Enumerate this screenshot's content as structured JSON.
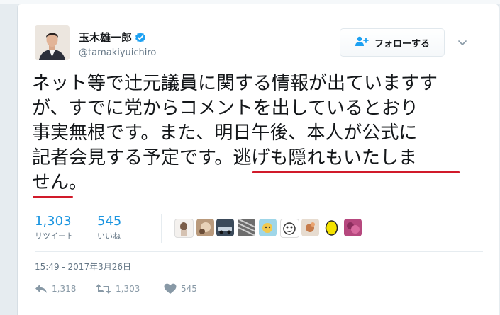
{
  "author": {
    "name": "玉木雄一郎",
    "handle": "@tamakiyuichiro",
    "verified": true
  },
  "follow_button": {
    "label": "フォローする"
  },
  "tweet": {
    "lines": [
      "ネット等で辻元議員に関する情報が出ていますす",
      "が、すでに党からコメントを出しているとおり",
      "事実無根です。また、明日午後、本人が公式に",
      "記者会見する予定です。逃げも隠れもいたしま",
      "せん。"
    ]
  },
  "stats": {
    "retweets": {
      "count": "1,303",
      "label": "リツイート"
    },
    "likes": {
      "count": "545",
      "label": "いいね"
    }
  },
  "timestamp": "15:49 - 2017年3月26日",
  "actions": {
    "reply_count": "1,318",
    "retweet_count": "1,303",
    "like_count": "545"
  },
  "colors": {
    "link": "#1b95e0",
    "underline_annotation": "#d11a2a",
    "text": "#14171a",
    "muted": "#657786"
  },
  "icons": [
    "verified-badge-icon",
    "follow-user-icon",
    "chevron-down-icon",
    "reply-icon",
    "retweet-icon",
    "heart-icon"
  ]
}
